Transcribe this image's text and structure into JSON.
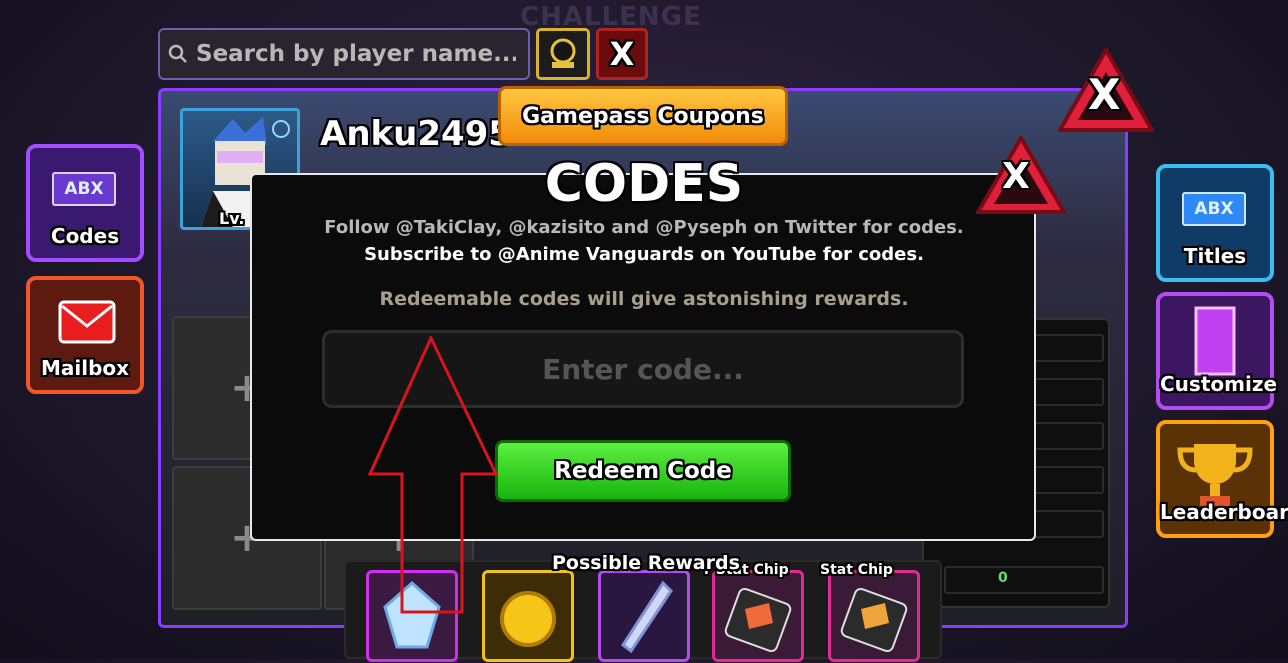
{
  "hud": {
    "challenge_label": "CHALLENGE",
    "search_placeholder": "Search by player name...",
    "close_small_label": "X"
  },
  "leaderboard_panel": {
    "player_name": "Anku2495",
    "level_label": "Lv.",
    "stat_value": "0",
    "close_label": "X"
  },
  "side_buttons": {
    "codes": {
      "label": "Codes",
      "tag": "ABX"
    },
    "mailbox": {
      "label": "Mailbox"
    },
    "titles": {
      "label": "Titles",
      "tag": "ABX"
    },
    "customize": {
      "label": "Customize"
    },
    "leaderboard": {
      "label": "Leaderboard"
    }
  },
  "codes_modal": {
    "gamepass_button": "Gamepass Coupons",
    "title": "CODES",
    "close_label": "X",
    "info_line_1": "Follow @TakiClay, @kazisito and @Pyseph on Twitter for codes.",
    "info_line_2": "Subscribe to @Anime Vanguards on YouTube for codes.",
    "info_line_3": "Redeemable codes will give astonishing rewards.",
    "input_placeholder": "Enter code...",
    "input_value": "",
    "redeem_button": "Redeem Code"
  },
  "rewards": {
    "title": "Possible Rewards",
    "items": [
      {
        "label": "",
        "icon": "crystal-icon"
      },
      {
        "label": "",
        "icon": "gold-coin-icon"
      },
      {
        "label": "",
        "icon": "shard-icon"
      },
      {
        "label": "r Stat Chip",
        "icon": "stat-chip-icon"
      },
      {
        "label": "Stat Chip",
        "icon": "stat-chip-icon"
      }
    ]
  },
  "colors": {
    "codes_accent": "#a44cff",
    "mailbox_accent": "#f2572a",
    "titles_accent": "#38bff2",
    "customize_accent": "#b44cf2",
    "leaderboard_accent": "#ffa012",
    "redeem_green": "#2ed61e",
    "gamepass_orange": "#f7a81e",
    "close_red": "#e0203a",
    "annotation_arrow": "#d8141c"
  }
}
